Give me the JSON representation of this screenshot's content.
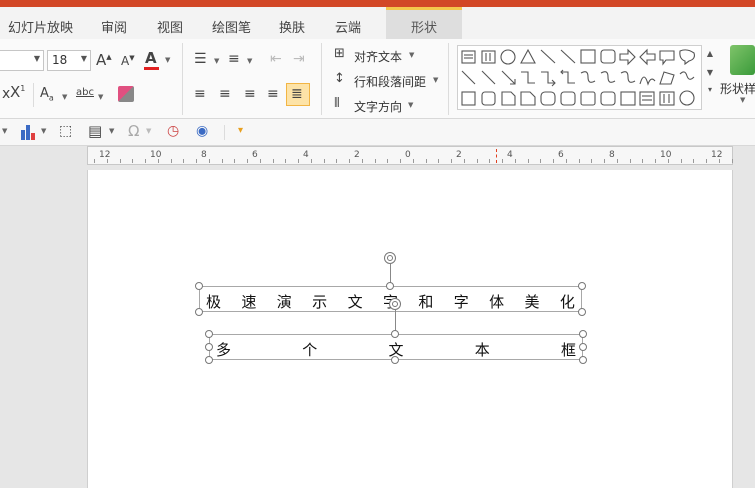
{
  "tabs": {
    "items": [
      "幻灯片放映",
      "审阅",
      "视图",
      "绘图笔",
      "换肤",
      "云端",
      "形状"
    ]
  },
  "ribbon": {
    "font_name": "",
    "font_size": "18",
    "align_text_label": "对齐文本",
    "line_spacing_label": "行和段落间距",
    "text_direction_label": "文字方向",
    "shape_style_label": "形状样"
  },
  "colors": {
    "accent": "#d24726",
    "font_color": "#e02020",
    "selected_highlight": "#fde3a7"
  },
  "ruler": {
    "labels": [
      "12",
      "10",
      "8",
      "6",
      "4",
      "2",
      "0",
      "2",
      "4",
      "6",
      "8",
      "10",
      "12"
    ]
  },
  "slide": {
    "textbox1": {
      "chars": [
        "极",
        "速",
        "演",
        "示",
        "文",
        "字",
        "和",
        "字",
        "体",
        "美",
        "化"
      ]
    },
    "textbox2": {
      "chars": [
        "多",
        "个",
        "文",
        "本",
        "框"
      ]
    }
  }
}
